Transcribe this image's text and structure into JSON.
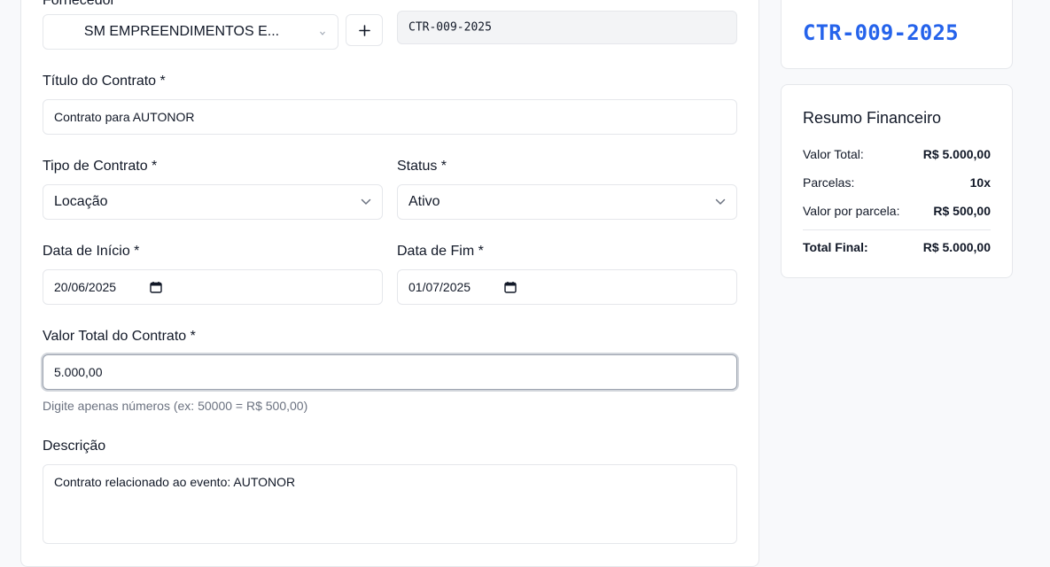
{
  "form": {
    "supplier": {
      "label": "Fornecedor",
      "selected": "SM EMPREENDIMENTOS E...",
      "add_button": "+"
    },
    "contract_code": "CTR-009-2025",
    "title": {
      "label": "Título do Contrato *",
      "value": "Contrato para AUTONOR"
    },
    "type": {
      "label": "Tipo de Contrato *",
      "selected": "Locação"
    },
    "status": {
      "label": "Status *",
      "selected": "Ativo"
    },
    "start_date": {
      "label": "Data de Início *",
      "value": "20/06/2025"
    },
    "end_date": {
      "label": "Data de Fim *",
      "value": "01/07/2025"
    },
    "total_value": {
      "label": "Valor Total do Contrato *",
      "value": "5.000,00",
      "helper": "Digite apenas números (ex: 50000 = R$ 500,00)"
    },
    "description": {
      "label": "Descrição",
      "value": "Contrato relacionado ao evento: AUTONOR"
    }
  },
  "sidebar": {
    "contract_code": "CTR-009-2025",
    "summary": {
      "title": "Resumo Financeiro",
      "rows": [
        {
          "label": "Valor Total:",
          "value": "R$ 5.000,00"
        },
        {
          "label": "Parcelas:",
          "value": "10x"
        },
        {
          "label": "Valor por parcela:",
          "value": "R$ 500,00"
        }
      ],
      "total": {
        "label": "Total Final:",
        "value": "R$ 5.000,00"
      }
    }
  },
  "colors": {
    "accent": "#2563eb",
    "border": "#e5e7eb",
    "readonly_bg": "#f3f4f6",
    "helper_text": "#6b7280"
  },
  "icons": {
    "select": "chevron-down-icon",
    "add": "plus-icon",
    "date": "calendar-icon"
  }
}
